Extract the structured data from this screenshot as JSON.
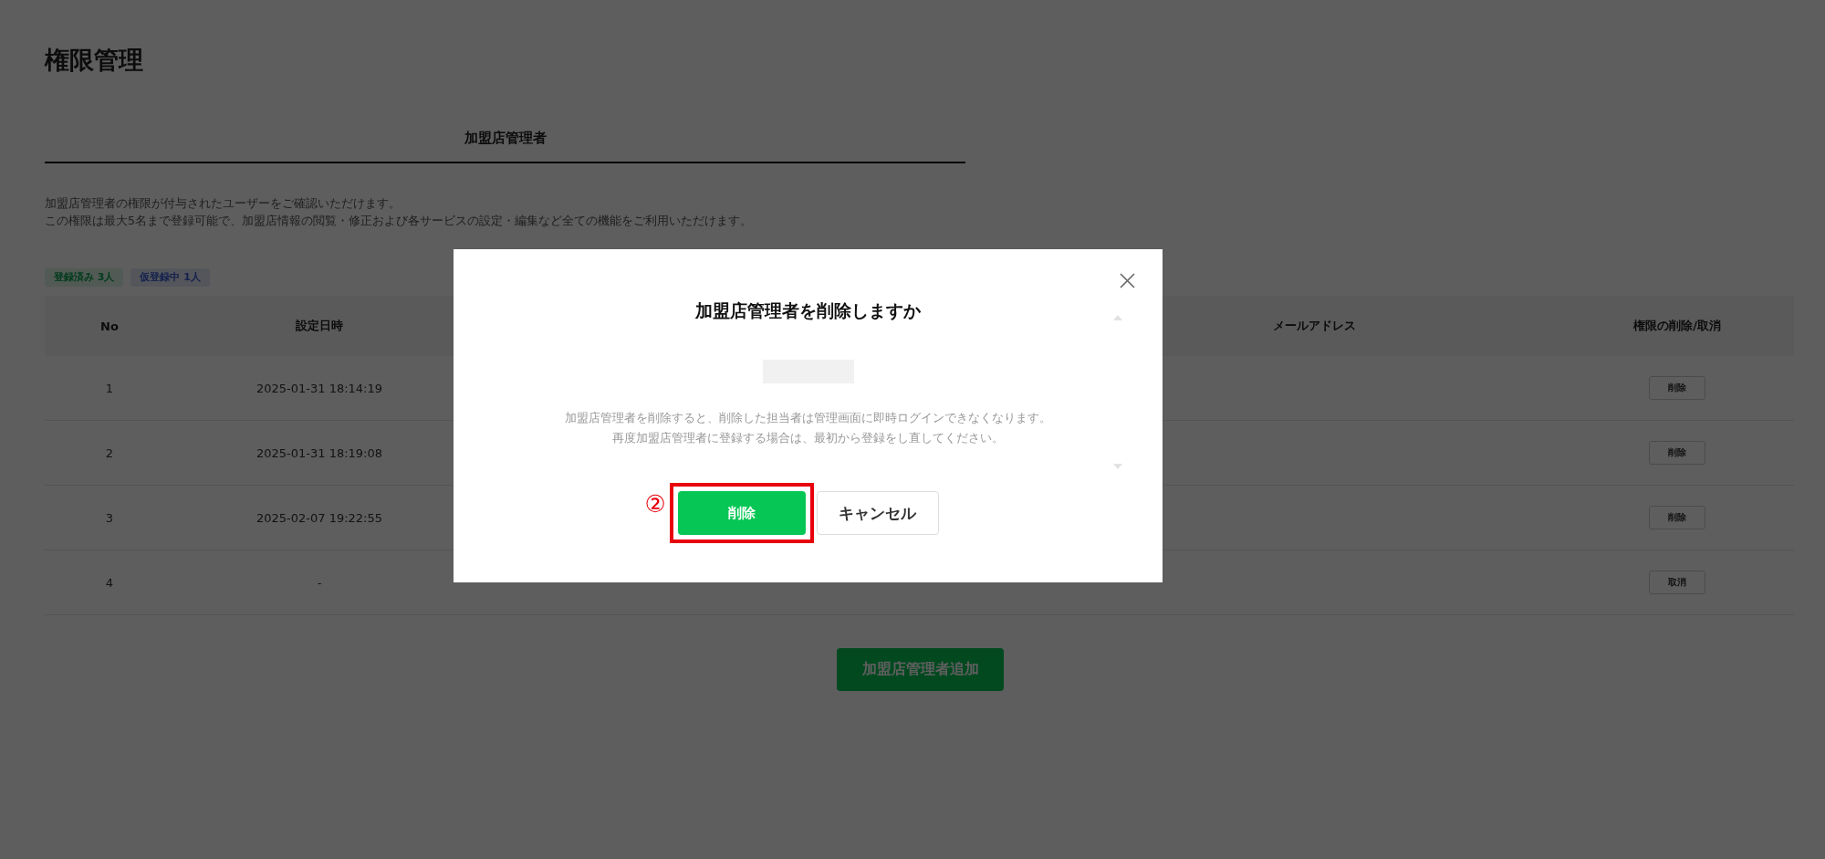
{
  "page": {
    "title": "権限管理"
  },
  "tabs": [
    {
      "label": "加盟店管理者",
      "selected": true
    }
  ],
  "description": [
    "加盟店管理者の権限が付与されたユーザーをご確認いただけます。",
    "この権限は最大5名まで登録可能で、加盟店情報の閲覧・修正および各サービスの設定・編集など全ての機能をご利用いただけます。"
  ],
  "badges": [
    {
      "label": "登録済み 3人",
      "kind": "registered"
    },
    {
      "label": "仮登録中 1人",
      "kind": "provisional"
    }
  ],
  "table": {
    "columns": [
      "No",
      "設定日時",
      "メールアドレス",
      "権限の削除/取消"
    ],
    "rows": [
      {
        "no": "1",
        "datetime": "2025-01-31 18:14:19",
        "action": "削除"
      },
      {
        "no": "2",
        "datetime": "2025-01-31 18:19:08",
        "action": "削除"
      },
      {
        "no": "3",
        "datetime": "2025-02-07 19:22:55",
        "action": "削除"
      },
      {
        "no": "4",
        "datetime": "-",
        "action": "取消"
      }
    ]
  },
  "add_button": {
    "label": "加盟店管理者追加"
  },
  "dialog": {
    "title": "加盟店管理者を削除しますか",
    "message": [
      "加盟店管理者を削除すると、削除した担当者は管理画面に即時ログインできなくなります。",
      "再度加盟店管理者に登録する場合は、最初から登録をし直してください。"
    ],
    "buttons": [
      {
        "label": "削除",
        "kind": "primary",
        "highlighted": true
      },
      {
        "label": "キャンセル",
        "kind": "secondary",
        "highlighted": false
      }
    ],
    "annotation": "②"
  }
}
